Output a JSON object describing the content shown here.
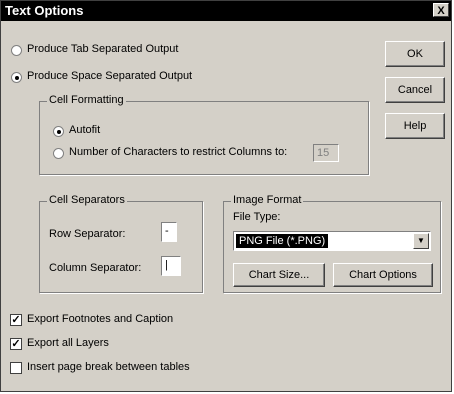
{
  "window": {
    "title": "Text Options",
    "close_glyph": "X"
  },
  "output_mode": {
    "tab_label": "Produce Tab Separated Output",
    "space_label": "Produce Space Separated Output",
    "selected": "space"
  },
  "cell_formatting": {
    "legend": "Cell Formatting",
    "autofit_label": "Autofit",
    "number_label": "Number of Characters to restrict Columns to:",
    "selected": "autofit",
    "num_chars_value": "15"
  },
  "cell_separators": {
    "legend": "Cell Separators",
    "row_label": "Row Separator:",
    "row_value": "-",
    "column_label": "Column Separator:",
    "column_value": "|"
  },
  "image_format": {
    "legend": "Image Format",
    "file_type_label": "File Type:",
    "file_type_value": "PNG File (*.PNG)",
    "chart_size_label": "Chart Size...",
    "chart_options_label": "Chart Options"
  },
  "options": {
    "export_footnotes_label": "Export Footnotes and Caption",
    "export_footnotes_checked": true,
    "export_layers_label": "Export all Layers",
    "export_layers_checked": true,
    "page_break_label": "Insert page break between tables",
    "page_break_checked": false
  },
  "buttons": {
    "ok": "OK",
    "cancel": "Cancel",
    "help": "Help"
  }
}
